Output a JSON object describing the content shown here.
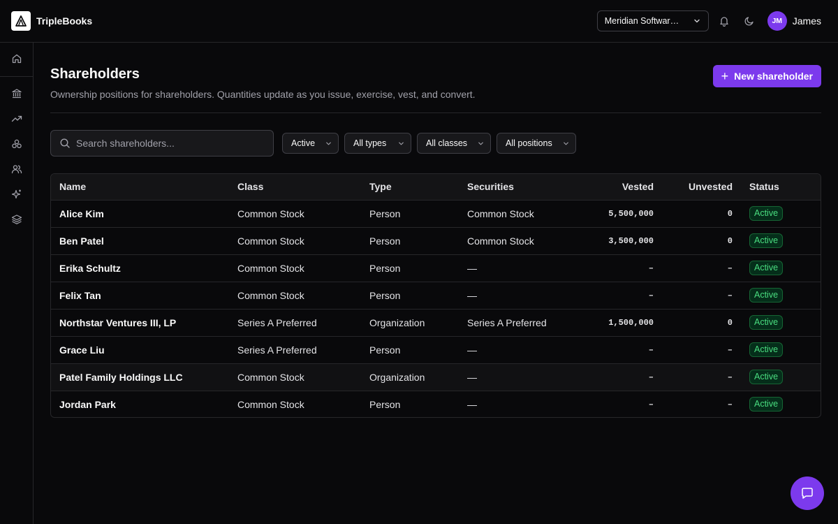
{
  "app": {
    "name": "TripleBooks"
  },
  "header": {
    "org_selector": "Meridian Software, Inc.",
    "user": {
      "initials": "JM",
      "name": "James"
    }
  },
  "sidebar": {
    "items": [
      {
        "icon": "home-icon"
      },
      {
        "icon": "bank-icon"
      },
      {
        "icon": "trending-up-icon"
      },
      {
        "icon": "cap-table-icon"
      },
      {
        "icon": "users-icon"
      },
      {
        "icon": "sparkles-icon"
      },
      {
        "icon": "layers-icon"
      }
    ]
  },
  "page": {
    "title": "Shareholders",
    "subtitle": "Ownership positions for shareholders. Quantities update as you issue, exercise, vest, and convert.",
    "new_button": "New shareholder"
  },
  "filters": {
    "search_placeholder": "Search shareholders...",
    "status": "Active",
    "type": "All types",
    "class": "All classes",
    "position": "All positions"
  },
  "table": {
    "columns": [
      "Name",
      "Class",
      "Type",
      "Securities",
      "Vested",
      "Unvested",
      "Status"
    ],
    "rows": [
      {
        "name": "Alice Kim",
        "class": "Common Stock",
        "type": "Person",
        "securities": "Common Stock",
        "vested": "5,500,000",
        "unvested": "0",
        "status": "Active"
      },
      {
        "name": "Ben Patel",
        "class": "Common Stock",
        "type": "Person",
        "securities": "Common Stock",
        "vested": "3,500,000",
        "unvested": "0",
        "status": "Active"
      },
      {
        "name": "Erika Schultz",
        "class": "Common Stock",
        "type": "Person",
        "securities": "—",
        "vested": "–",
        "unvested": "–",
        "status": "Active"
      },
      {
        "name": "Felix Tan",
        "class": "Common Stock",
        "type": "Person",
        "securities": "—",
        "vested": "–",
        "unvested": "–",
        "status": "Active"
      },
      {
        "name": "Northstar Ventures III, LP",
        "class": "Series A Preferred",
        "type": "Organization",
        "securities": "Series A Preferred",
        "vested": "1,500,000",
        "unvested": "0",
        "status": "Active"
      },
      {
        "name": "Grace Liu",
        "class": "Series A Preferred",
        "type": "Person",
        "securities": "—",
        "vested": "–",
        "unvested": "–",
        "status": "Active"
      },
      {
        "name": "Patel Family Holdings LLC",
        "class": "Common Stock",
        "type": "Organization",
        "securities": "—",
        "vested": "–",
        "unvested": "–",
        "status": "Active"
      },
      {
        "name": "Jordan Park",
        "class": "Common Stock",
        "type": "Person",
        "securities": "—",
        "vested": "–",
        "unvested": "–",
        "status": "Active"
      }
    ]
  },
  "colors": {
    "accent": "#7c3aed",
    "background": "#09090b",
    "status_active": "#4ade80"
  }
}
